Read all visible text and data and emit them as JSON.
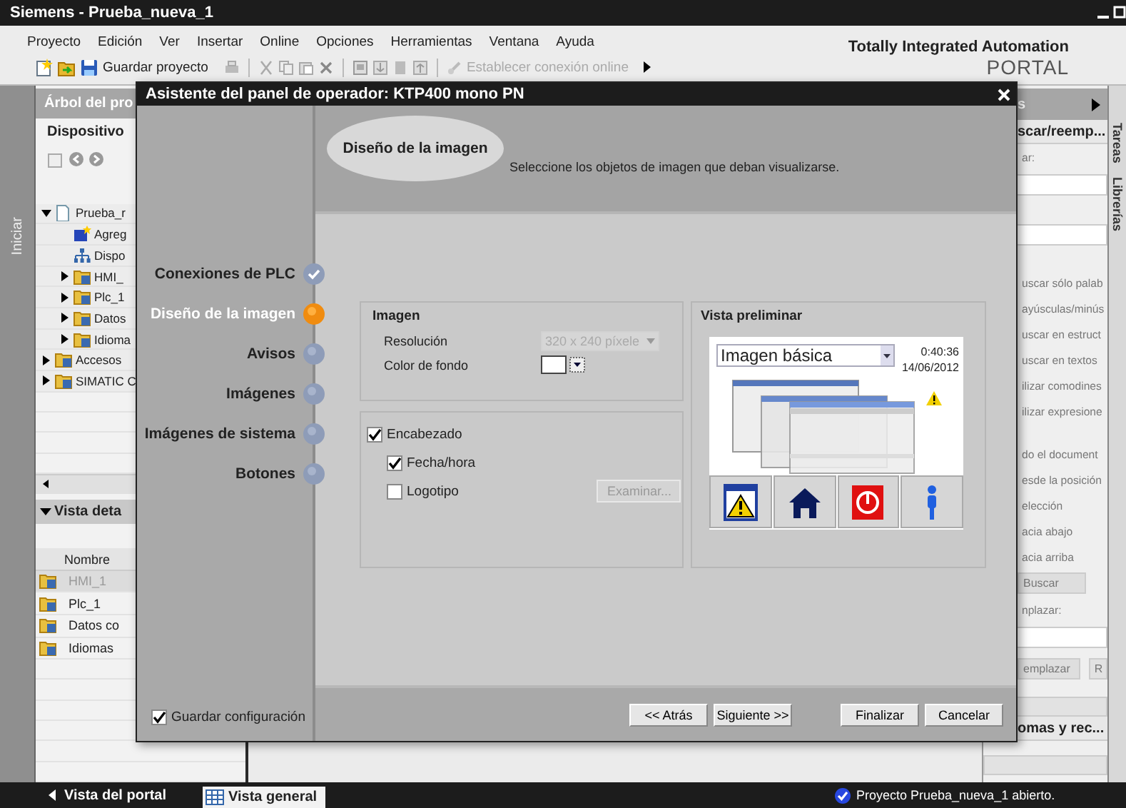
{
  "window": {
    "title": "Siemens - Prueba_nueva_1"
  },
  "menu": [
    "Proyecto",
    "Edición",
    "Ver",
    "Insertar",
    "Online",
    "Opciones",
    "Herramientas",
    "Ventana",
    "Ayuda"
  ],
  "toolbar": {
    "save_label": "Guardar proyecto",
    "connect_label": "Establecer conexión online",
    "connect_disabled": true
  },
  "brand": {
    "title": "Totally Integrated Automation",
    "subtitle": "PORTAL"
  },
  "start_tab": {
    "label": "Iniciar"
  },
  "project_tree": {
    "title": "Árbol del pro",
    "section": "Dispositivo",
    "items": [
      {
        "label": "Prueba_r",
        "kind": "document",
        "expanded": true,
        "children": [
          {
            "label": "Agreg",
            "kind": "add"
          },
          {
            "label": "Dispo",
            "kind": "network"
          },
          {
            "label": "HMI_",
            "kind": "folder",
            "expanded": false
          },
          {
            "label": "Plc_1",
            "kind": "folder",
            "expanded": false
          },
          {
            "label": "Datos",
            "kind": "folder",
            "expanded": false
          },
          {
            "label": "Idioma",
            "kind": "folder",
            "expanded": false
          }
        ]
      },
      {
        "label": "Accesos",
        "kind": "folder",
        "expanded": false
      },
      {
        "label": "SIMATIC C",
        "kind": "folder",
        "expanded": false
      }
    ]
  },
  "detail_view": {
    "title": "Vista deta",
    "column": "Nombre",
    "rows": [
      {
        "label": "HMI_1",
        "selected": true
      },
      {
        "label": "Plc_1",
        "selected": false
      },
      {
        "label": "Datos co",
        "selected": false
      },
      {
        "label": "Idiomas",
        "selected": false
      }
    ]
  },
  "task_panel": {
    "title": "s",
    "section": "scar/reemp...",
    "find_label": "ar:",
    "options": [
      "uscar sólo palab",
      "ayúsculas/minús",
      "uscar en estruct",
      "uscar en textos",
      "ilizar comodines",
      "ilizar expresione"
    ],
    "scope": [
      "do el document",
      "esde la posición",
      "elección"
    ],
    "direction": [
      "acia abajo",
      "acia arriba"
    ],
    "find_button": "Buscar",
    "replace_label": "nplazar:",
    "replace_button": "emplazar",
    "replace_all_button": "R",
    "next_section": "omas y rec..."
  },
  "side_tabs": [
    "Tareas",
    "Librerías"
  ],
  "dialog": {
    "title": "Asistente del panel de operador: KTP400 mono PN",
    "steps": [
      {
        "label": "Conexiones de PLC",
        "kind": "done"
      },
      {
        "label": "Diseño de la imagen",
        "kind": "current"
      },
      {
        "label": "Avisos",
        "kind": "pending"
      },
      {
        "label": "Imágenes",
        "kind": "pending"
      },
      {
        "label": "Imágenes de sistema",
        "kind": "pending"
      },
      {
        "label": "Botones",
        "kind": "pending"
      }
    ],
    "heading": "Diseño de la imagen",
    "instruction": "Seleccione los objetos de imagen que deban visualizarse.",
    "image_group": {
      "title": "Imagen",
      "resolution_label": "Resolución",
      "resolution_value": "320 x 240 píxele",
      "resolution_disabled": true,
      "background_label": "Color de fondo"
    },
    "header_group": {
      "options": [
        {
          "label": "Encabezado",
          "checked": true,
          "children": [
            {
              "label": "Fecha/hora",
              "checked": true
            },
            {
              "label": "Logotipo",
              "checked": false
            }
          ]
        }
      ],
      "browse_button": "Examinar...",
      "browse_disabled": true
    },
    "preview": {
      "title": "Vista preliminar",
      "screen": "Imagen básica",
      "time": "0:40:36",
      "date": "14/06/2012"
    },
    "save_settings": {
      "label": "Guardar configuración",
      "checked": true
    },
    "buttons": [
      "<< Atrás",
      "Siguiente >>",
      "Finalizar",
      "Cancelar"
    ]
  },
  "status_bar": {
    "portal_link": "Vista del portal",
    "view_tab": "Vista general",
    "message": "Proyecto Prueba_nueva_1 abierto."
  }
}
